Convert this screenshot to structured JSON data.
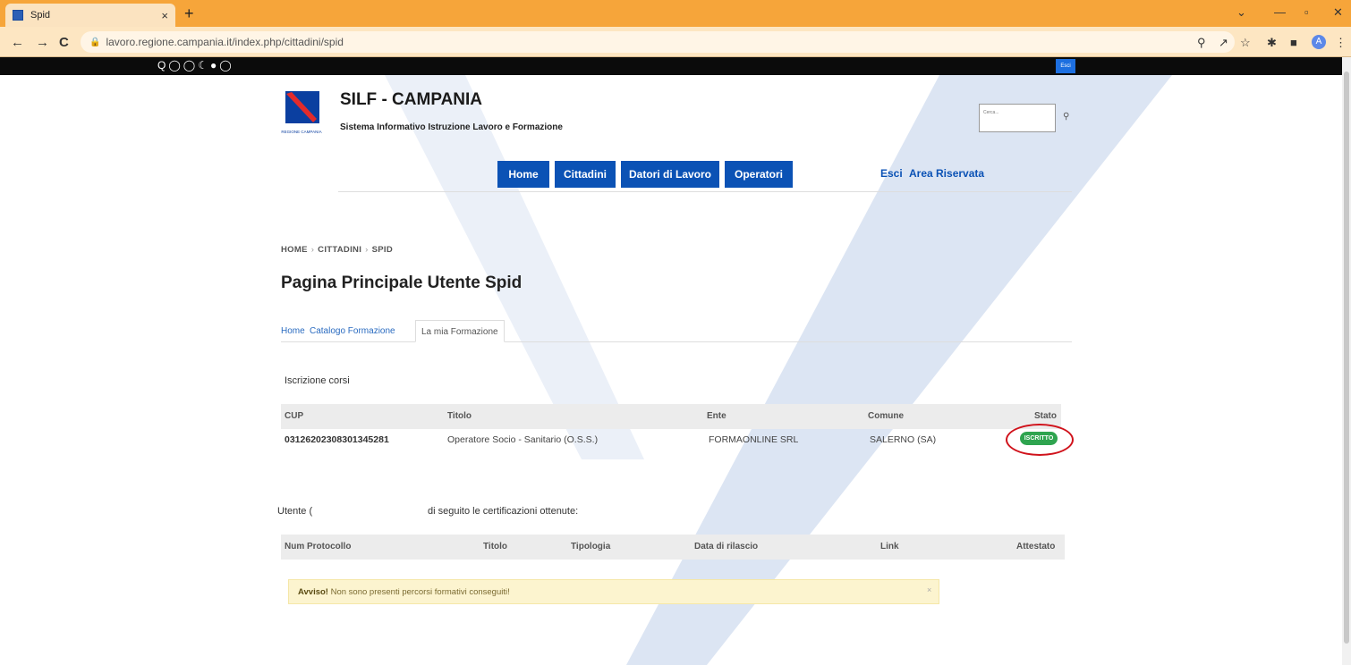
{
  "browser": {
    "tab_title": "Spid",
    "tab_close": "×",
    "new_tab": "+",
    "url": "lavoro.regione.campania.it/index.php/cittadini/spid",
    "back": "←",
    "forward": "→",
    "reload": "C",
    "avatar_letter": "A",
    "win_minimize": "—",
    "win_maximize": "▫",
    "win_close": "✕",
    "win_dropdown": "⌄"
  },
  "accessibility": {
    "icons": "Q◯◯☾●◯",
    "exit_label": "Esci"
  },
  "header": {
    "title": "SILF - CAMPANIA",
    "subtitle": "Sistema Informativo Istruzione Lavoro e Formazione",
    "logo_text": "REGIONE CAMPANIA",
    "search_placeholder": "Cerca..."
  },
  "nav": {
    "items": [
      {
        "label": "Home"
      },
      {
        "label": "Cittadini"
      },
      {
        "label": "Datori di Lavoro"
      },
      {
        "label": "Operatori"
      }
    ],
    "esci": "Esci",
    "area_riservata": "Area Riservata"
  },
  "breadcrumb": {
    "items": [
      "HOME",
      "CITTADINI",
      "SPID"
    ],
    "separator": "›"
  },
  "page_title": "Pagina Principale Utente Spid",
  "tabs": [
    {
      "label": "Home"
    },
    {
      "label": "Catalogo Formazione"
    },
    {
      "label": "La mia Formazione"
    }
  ],
  "courses": {
    "section_title": "Iscrizione corsi",
    "headers": [
      "CUP",
      "Titolo",
      "Ente",
      "Comune",
      "Stato"
    ],
    "rows": [
      {
        "cup": "03126202308301345281",
        "titolo": "Operatore Socio - Sanitario (O.S.S.)",
        "ente": "FORMAONLINE SRL",
        "comune": "SALERNO (SA)",
        "stato": "ISCRITTO"
      }
    ]
  },
  "certifications": {
    "intro_prefix": "Utente (",
    "intro_suffix": "di seguito le certificazioni ottenute:",
    "headers": [
      "Num Protocollo",
      "Titolo",
      "Tipologia",
      "Data di rilascio",
      "Link",
      "Attestato"
    ],
    "alert_bold": "Avviso!",
    "alert_text": "Non sono presenti percorsi formativi conseguiti!",
    "alert_close": "×"
  },
  "colors": {
    "accent": "#0b52b5",
    "status_ok": "#2ea44f",
    "highlight_circle": "#d0121b",
    "browser_frame": "#f6a53a"
  }
}
